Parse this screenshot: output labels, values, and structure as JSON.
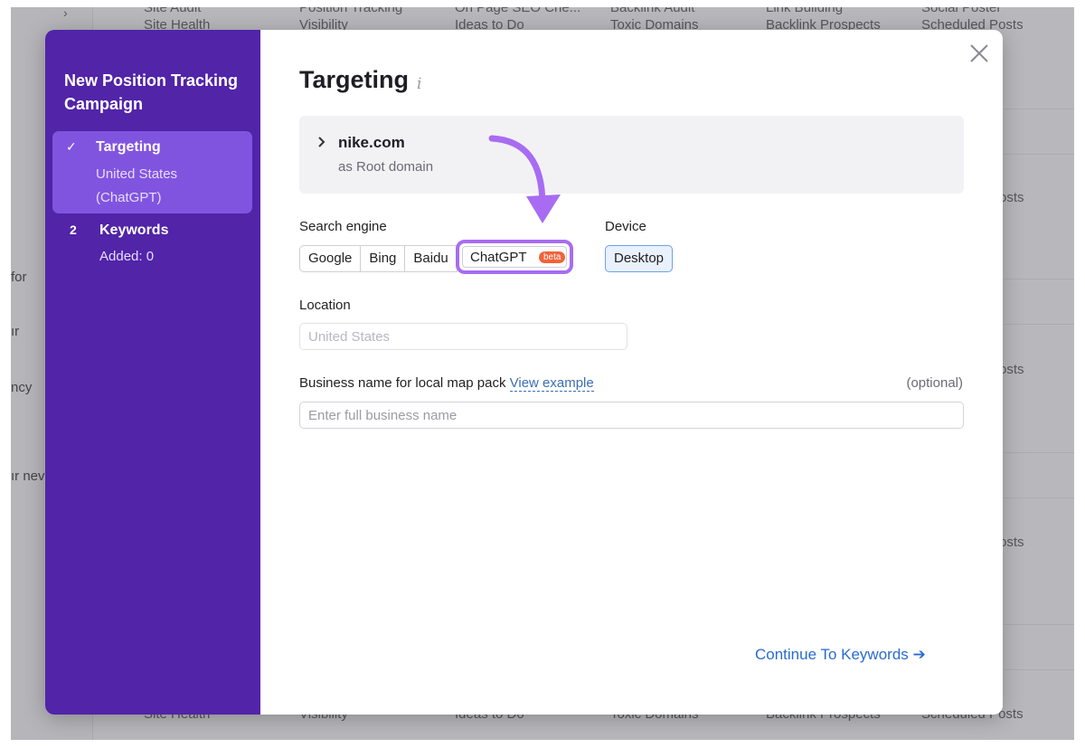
{
  "background": {
    "left_fragments": [
      "for",
      "ır",
      "ncy",
      "ır nev"
    ],
    "top_row": [
      "Site Audit",
      "Position Tracking",
      "On Page SEO Che...",
      "Backlink Audit",
      "Link Building",
      "Social Poster"
    ],
    "top_row_sub": [
      "Site Health",
      "Visibility",
      "Ideas to Do",
      "Toxic Domains",
      "Backlink Prospects",
      "Scheduled Posts"
    ],
    "right_fragments": [
      "osts",
      "osts",
      "osts",
      "osts"
    ],
    "bottom_row": [
      "Site Health",
      "Visibility",
      "Ideas to Do",
      "Toxic Domains",
      "Backlink Prospects",
      "Scheduled Posts"
    ]
  },
  "sidebar": {
    "title": "New Position Tracking Campaign",
    "steps": [
      {
        "mark": "✓",
        "name": "Targeting",
        "sub": "United States (ChatGPT)"
      },
      {
        "mark": "2",
        "name": "Keywords",
        "sub": "Added: 0"
      }
    ]
  },
  "main": {
    "title": "Targeting",
    "info_icon": "i",
    "domain": {
      "name": "nike.com",
      "sub": "as Root domain"
    },
    "search_engine": {
      "label": "Search engine",
      "options": [
        "Google",
        "Bing",
        "Baidu",
        "ChatGPT"
      ],
      "badge": "beta",
      "selected": "ChatGPT"
    },
    "device": {
      "label": "Device",
      "selected": "Desktop"
    },
    "location": {
      "label": "Location",
      "placeholder": "United States"
    },
    "business": {
      "label": "Business name for local map pack",
      "link": "View example",
      "optional": "(optional)",
      "placeholder": "Enter full business name"
    },
    "continue_label": "Continue To Keywords ➔"
  },
  "colors": {
    "sidebar": "#5124a8",
    "active_step": "#8154e0",
    "highlight": "#a86cf2",
    "link": "#2a6bd1",
    "beta": "#f0633a"
  }
}
